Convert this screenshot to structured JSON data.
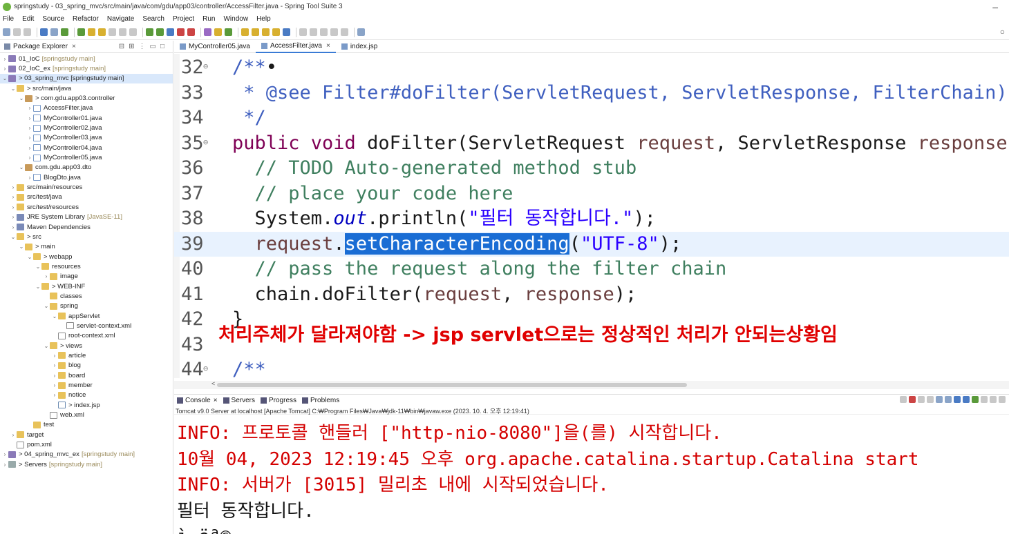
{
  "window": {
    "title": "springstudy - 03_spring_mvc/src/main/java/com/gdu/app03/controller/AccessFilter.java - Spring Tool Suite 3",
    "minimize_glyph": "–"
  },
  "menu": [
    "File",
    "Edit",
    "Source",
    "Refactor",
    "Navigate",
    "Search",
    "Project",
    "Run",
    "Window",
    "Help"
  ],
  "explorer": {
    "title": "Package Explorer",
    "close_glyph": "×",
    "tree": [
      {
        "depth": 0,
        "twisty": ">",
        "icon": "project",
        "label": "01_IoC",
        "extra": "[springstudy main]"
      },
      {
        "depth": 0,
        "twisty": ">",
        "icon": "project",
        "label": "02_IoC_ex",
        "extra": "[springstudy main]"
      },
      {
        "depth": 0,
        "twisty": "v",
        "icon": "project",
        "label": "> 03_spring_mvc [springstudy main]",
        "extra": "",
        "selected": true
      },
      {
        "depth": 1,
        "twisty": "v",
        "icon": "folder",
        "label": "> src/main/java",
        "extra": ""
      },
      {
        "depth": 2,
        "twisty": "v",
        "icon": "pkg",
        "label": "> com.gdu.app03.controller",
        "extra": ""
      },
      {
        "depth": 3,
        "twisty": ">",
        "icon": "java",
        "label": "AccessFilter.java",
        "extra": ""
      },
      {
        "depth": 3,
        "twisty": ">",
        "icon": "java",
        "label": "MyController01.java",
        "extra": ""
      },
      {
        "depth": 3,
        "twisty": ">",
        "icon": "java",
        "label": "MyController02.java",
        "extra": ""
      },
      {
        "depth": 3,
        "twisty": ">",
        "icon": "java",
        "label": "MyController03.java",
        "extra": ""
      },
      {
        "depth": 3,
        "twisty": ">",
        "icon": "java",
        "label": "MyController04.java",
        "extra": ""
      },
      {
        "depth": 3,
        "twisty": ">",
        "icon": "java",
        "label": "MyController05.java",
        "extra": ""
      },
      {
        "depth": 2,
        "twisty": "v",
        "icon": "pkg",
        "label": "com.gdu.app03.dto",
        "extra": ""
      },
      {
        "depth": 3,
        "twisty": ">",
        "icon": "java",
        "label": "BlogDto.java",
        "extra": ""
      },
      {
        "depth": 1,
        "twisty": ">",
        "icon": "folder",
        "label": "src/main/resources",
        "extra": ""
      },
      {
        "depth": 1,
        "twisty": ">",
        "icon": "folder",
        "label": "src/test/java",
        "extra": ""
      },
      {
        "depth": 1,
        "twisty": ">",
        "icon": "folder",
        "label": "src/test/resources",
        "extra": ""
      },
      {
        "depth": 1,
        "twisty": ">",
        "icon": "lib",
        "label": "JRE System Library",
        "extra": "[JavaSE-11]"
      },
      {
        "depth": 1,
        "twisty": ">",
        "icon": "lib",
        "label": "Maven Dependencies",
        "extra": ""
      },
      {
        "depth": 1,
        "twisty": "v",
        "icon": "folder",
        "label": "> src",
        "extra": ""
      },
      {
        "depth": 2,
        "twisty": "v",
        "icon": "folder",
        "label": "> main",
        "extra": ""
      },
      {
        "depth": 3,
        "twisty": "v",
        "icon": "folder",
        "label": "> webapp",
        "extra": ""
      },
      {
        "depth": 4,
        "twisty": "v",
        "icon": "folder",
        "label": "resources",
        "extra": ""
      },
      {
        "depth": 5,
        "twisty": ">",
        "icon": "folder",
        "label": "image",
        "extra": ""
      },
      {
        "depth": 4,
        "twisty": "v",
        "icon": "folder",
        "label": "> WEB-INF",
        "extra": ""
      },
      {
        "depth": 5,
        "twisty": "",
        "icon": "folder",
        "label": "classes",
        "extra": ""
      },
      {
        "depth": 5,
        "twisty": "v",
        "icon": "folder",
        "label": "spring",
        "extra": ""
      },
      {
        "depth": 6,
        "twisty": "v",
        "icon": "folder",
        "label": "appServlet",
        "extra": ""
      },
      {
        "depth": 7,
        "twisty": "",
        "icon": "xml",
        "label": "servlet-context.xml",
        "extra": ""
      },
      {
        "depth": 6,
        "twisty": "",
        "icon": "xml",
        "label": "root-context.xml",
        "extra": ""
      },
      {
        "depth": 5,
        "twisty": "v",
        "icon": "folder",
        "label": "> views",
        "extra": ""
      },
      {
        "depth": 6,
        "twisty": ">",
        "icon": "folder",
        "label": "article",
        "extra": ""
      },
      {
        "depth": 6,
        "twisty": ">",
        "icon": "folder",
        "label": "blog",
        "extra": ""
      },
      {
        "depth": 6,
        "twisty": ">",
        "icon": "folder",
        "label": "board",
        "extra": ""
      },
      {
        "depth": 6,
        "twisty": ">",
        "icon": "folder",
        "label": "member",
        "extra": ""
      },
      {
        "depth": 6,
        "twisty": ">",
        "icon": "folder",
        "label": "notice",
        "extra": ""
      },
      {
        "depth": 6,
        "twisty": "",
        "icon": "jsp",
        "label": "> index.jsp",
        "extra": ""
      },
      {
        "depth": 5,
        "twisty": "",
        "icon": "xml",
        "label": "web.xml",
        "extra": ""
      },
      {
        "depth": 3,
        "twisty": "",
        "icon": "folder",
        "label": "test",
        "extra": ""
      },
      {
        "depth": 1,
        "twisty": ">",
        "icon": "folder",
        "label": "target",
        "extra": ""
      },
      {
        "depth": 1,
        "twisty": "",
        "icon": "xml",
        "label": "pom.xml",
        "extra": ""
      },
      {
        "depth": 0,
        "twisty": ">",
        "icon": "project",
        "label": "> 04_spring_mvc_ex",
        "extra": "[springstudy main]"
      },
      {
        "depth": 0,
        "twisty": ">",
        "icon": "server",
        "label": "> Servers",
        "extra": "[springstudy main]"
      }
    ]
  },
  "editor": {
    "tabs": [
      {
        "label": "MyController05.java",
        "active": false
      },
      {
        "label": "AccessFilter.java",
        "active": true
      },
      {
        "label": "index.jsp",
        "active": false
      }
    ],
    "tab_close_glyph": "×",
    "lines": [
      {
        "num": "32",
        "fold": "⊖",
        "tokens": [
          [
            "jd",
            "/**"
          ],
          [
            "",
            "•"
          ]
        ]
      },
      {
        "num": "33",
        "fold": "",
        "tokens": [
          [
            "jd",
            " * @see Filter#doFilter(ServletRequest, ServletResponse, FilterChain)"
          ]
        ]
      },
      {
        "num": "34",
        "fold": "",
        "tokens": [
          [
            "jd",
            " */"
          ]
        ]
      },
      {
        "num": "35",
        "fold": "⊖",
        "tokens": [
          [
            "kw",
            "public void "
          ],
          [
            "",
            "doFilter(ServletRequest "
          ],
          [
            "var",
            "request"
          ],
          [
            "",
            ", ServletResponse "
          ],
          [
            "var",
            "response"
          ],
          [
            "",
            ","
          ]
        ]
      },
      {
        "num": "36",
        "fold": "",
        "tokens": [
          [
            "cm",
            "  // TODO Auto-generated method stub"
          ]
        ]
      },
      {
        "num": "37",
        "fold": "",
        "tokens": [
          [
            "cm",
            "  // place your code here"
          ]
        ]
      },
      {
        "num": "38",
        "fold": "",
        "tokens": [
          [
            "",
            "  System."
          ],
          [
            "fld",
            "out"
          ],
          [
            "",
            ".println("
          ],
          [
            "str",
            "\"필터 동작합니다.\""
          ],
          [
            "",
            ");"
          ]
        ]
      },
      {
        "num": "39",
        "fold": "",
        "highlight": true,
        "tokens": [
          [
            "var",
            "  request"
          ],
          [
            "",
            "."
          ],
          [
            "sel",
            "setCharacterEncoding"
          ],
          [
            "",
            "("
          ],
          [
            "str",
            "\"UTF-8\""
          ],
          [
            "",
            ");"
          ]
        ]
      },
      {
        "num": "40",
        "fold": "",
        "tokens": [
          [
            "cm",
            "  // pass the request along the filter chain"
          ]
        ]
      },
      {
        "num": "41",
        "fold": "",
        "tokens": [
          [
            "",
            "  chain.doFilter("
          ],
          [
            "var",
            "request"
          ],
          [
            "",
            ", "
          ],
          [
            "var",
            "response"
          ],
          [
            "",
            ");"
          ]
        ]
      },
      {
        "num": "42",
        "fold": "",
        "tokens": [
          [
            "",
            "}"
          ]
        ]
      },
      {
        "num": "43",
        "fold": "",
        "tokens": [
          [
            "",
            ""
          ]
        ]
      },
      {
        "num": "44",
        "fold": "⊖",
        "tokens": [
          [
            "jd",
            "/**"
          ]
        ]
      }
    ],
    "overlay_note": "처리주체가 달라져야함 -> jsp servlet으로는 정상적인 처리가 안되는상황임",
    "hscroll_arrow": "<"
  },
  "console": {
    "tabs": [
      "Console",
      "Servers",
      "Progress",
      "Problems"
    ],
    "launch_line": "Tomcat v9.0 Server at localhost [Apache Tomcat] C:₩Program Files₩Java₩jdk-11₩bin₩javaw.exe  (2023. 10. 4. 오후 12:19:41)",
    "output": [
      {
        "style": "red",
        "text": "INFO: 프로토콜 핸들러 [\"http-nio-8080\"]을(를) 시작합니다."
      },
      {
        "style": "red",
        "text": "10월 04, 2023 12:19:45 오후 org.apache.catalina.startup.Catalina start"
      },
      {
        "style": "red",
        "text": "INFO: 서버가 [3015] 밀리초 내에 시작되었습니다."
      },
      {
        "style": "black",
        "text": "필터 동작합니다."
      },
      {
        "style": "black",
        "text": "ì ëª©"
      }
    ]
  },
  "colors": {
    "keyword": "#7f0055",
    "comment": "#3f7f5f",
    "javadoc": "#3f5fbf",
    "string": "#2a00ff",
    "selection": "#1a6dd4",
    "overlay_red": "#e00000",
    "console_red": "#d40000"
  }
}
